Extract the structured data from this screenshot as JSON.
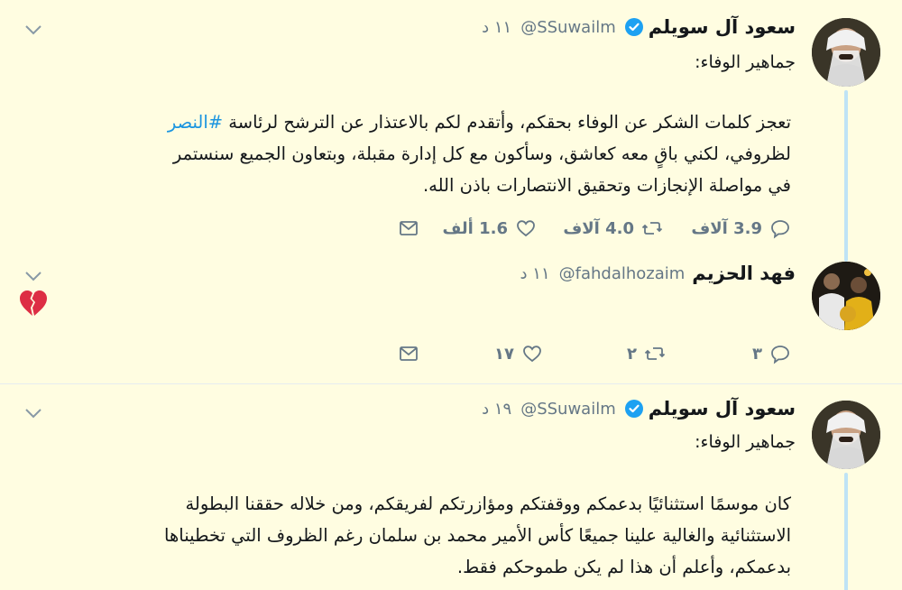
{
  "tweets": [
    {
      "author_name": "سعود آل سويلم",
      "verified": true,
      "handle": "@SSuwailm",
      "time": "١١ د",
      "replying_to": "جماهير الوفاء:",
      "text_before_hashtag": "تعجز كلمات الشكر عن الوفاء بحقكم، وأتقدم لكم بالاعتذار عن الترشح لرئاسة",
      "hashtag": "#النصر",
      "text_line2": "لظروفي، لكني باقٍ معه كعاشق، وسأكون مع كل إدارة مقبلة، وبتعاون الجميع سنستمر",
      "text_line3": "في مواصلة الإنجازات وتحقيق الانتصارات باذن الله.",
      "replies": "3.9 آلاف",
      "retweets": "4.0 آلاف",
      "likes": "1.6 ألف",
      "avatar_icon": "user-avatar-photo"
    },
    {
      "author_name": "فهد الحزيم",
      "verified": false,
      "handle": "@fahdalhozaim",
      "time": "١١ د",
      "emoji": "broken-heart-icon",
      "replies": "٣",
      "retweets": "٢",
      "likes": "١٧",
      "avatar_icon": "user-avatar-photo"
    },
    {
      "author_name": "سعود آل سويلم",
      "verified": true,
      "handle": "@SSuwailm",
      "time": "١٩ د",
      "replying_to": "جماهير الوفاء:",
      "text_line1": "كان موسمًا استثنائيًا بدعمكم ووقفتكم ومؤازرتكم لفريقكم، ومن خلاله حققنا البطولة",
      "text_line2": "الاستثنائية والغالية علينا جميعًا كأس الأمير محمد بن سلمان رغم الظروف التي تخطيناها",
      "text_line3": "بدعمكم، وأعلم أن هذا لم يكن طموحكم فقط.",
      "avatar_icon": "user-avatar-photo"
    }
  ],
  "colors": {
    "background": "#fffde1",
    "link": "#1b95e0",
    "secondary_text": "#657786",
    "thread_line": "#bfe3f5",
    "verified": "#1da1f2"
  }
}
